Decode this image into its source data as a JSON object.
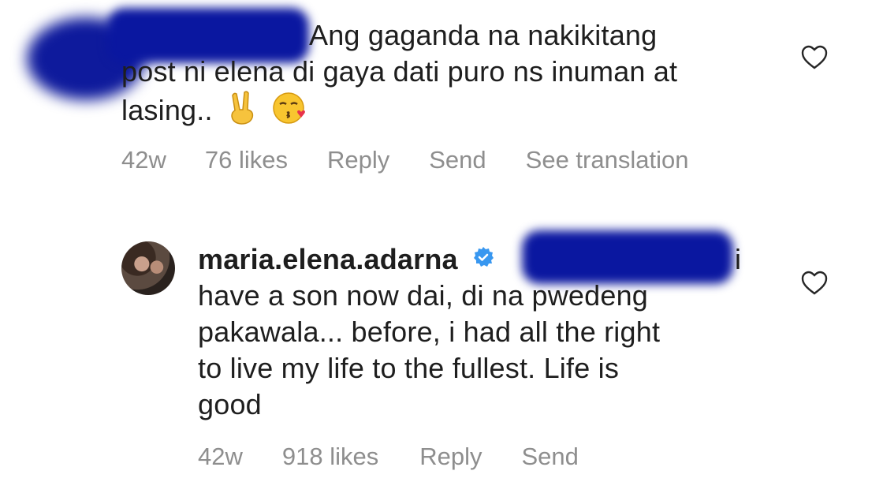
{
  "comment1": {
    "lines": [
      "Ang gaganda na nakikitang",
      "post ni elena di gaya dati puro ns inuman at",
      "lasing.."
    ],
    "emojis": [
      "victory-hand-emoji",
      "face-blowing-kiss-emoji"
    ],
    "meta": {
      "age": "42w",
      "likes": "76 likes",
      "reply": "Reply",
      "send": "Send",
      "translate": "See translation"
    }
  },
  "comment2": {
    "username": "maria.elena.adarna",
    "verified_icon": "verified-badge-icon",
    "lines": [
      "i",
      "have a son now dai, di na pwedeng",
      "pakawala... before, i had all the right",
      "to live my life to the fullest. Life is",
      "good"
    ],
    "meta": {
      "age": "42w",
      "likes": "918 likes",
      "reply": "Reply",
      "send": "Send"
    }
  },
  "colors": {
    "text": "#1e1e1e",
    "meta": "#8e8e8e",
    "redaction": "#0a17a0",
    "verified": "#3897f0"
  }
}
